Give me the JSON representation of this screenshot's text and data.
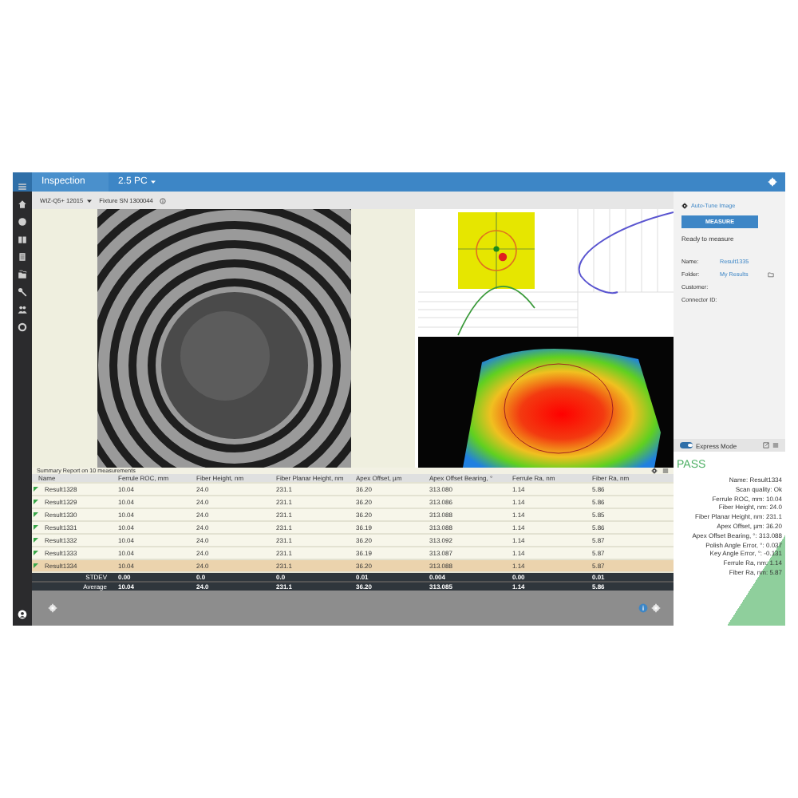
{
  "title_bar": {
    "app_title": "Inspection",
    "profile": "2.5 PC"
  },
  "sub_bar": {
    "device": "WIZ-Q5+ 12015",
    "fixture": "Fixture SN 1300044"
  },
  "control_panel": {
    "auto_tune": "Auto-Tune Image",
    "measure_button": "MEASURE",
    "status": "Ready to measure",
    "fields": [
      {
        "label": "Name:",
        "value": "Result1335"
      },
      {
        "label": "Folder:",
        "value": "My Results"
      },
      {
        "label": "Customer:"
      },
      {
        "label": "Connector ID:"
      }
    ]
  },
  "express_mode": {
    "label": "Express Mode",
    "on": true
  },
  "result": {
    "verdict": "PASS",
    "lines": [
      {
        "label": "Name:",
        "value": "Result1334"
      },
      {
        "label": "Scan quality:",
        "value": "Ok"
      },
      {
        "label": "Ferrule ROC, mm:",
        "value": "10.04"
      },
      {
        "label": "Fiber Height, nm:",
        "value": "24.0"
      },
      {
        "label": "Fiber Planar Height, nm:",
        "value": "231.1"
      },
      {
        "label": "Apex Offset, µm:",
        "value": "36.20"
      },
      {
        "label": "Apex Offset Bearing, °:",
        "value": "313.088"
      },
      {
        "label": "Polish Angle Error, °:",
        "value": "0.037"
      },
      {
        "label": "Key Angle Error, °:",
        "value": "-0.131"
      },
      {
        "label": "Ferrule Ra, nm:",
        "value": "1.14"
      },
      {
        "label": "Fiber Ra, nm:",
        "value": "5.87"
      }
    ]
  },
  "summary_table": {
    "title": "Summary Report on 10 measurements",
    "columns": [
      "Name",
      "Ferrule ROC, mm",
      "Fiber Height, nm",
      "Fiber Planar Height, nm",
      "Apex Offset, µm",
      "Apex Offset Bearing, °",
      "Ferrule Ra, nm",
      "Fiber Ra, nm"
    ],
    "rows": [
      {
        "flagged": true,
        "selected": false,
        "cells": [
          "Result1328",
          "10.04",
          "24.0",
          "231.1",
          "36.20",
          "313.080",
          "1.14",
          "5.86"
        ]
      },
      {
        "flagged": true,
        "selected": false,
        "cells": [
          "Result1329",
          "10.04",
          "24.0",
          "231.1",
          "36.20",
          "313.086",
          "1.14",
          "5.86"
        ]
      },
      {
        "flagged": true,
        "selected": false,
        "cells": [
          "Result1330",
          "10.04",
          "24.0",
          "231.1",
          "36.20",
          "313.088",
          "1.14",
          "5.85"
        ]
      },
      {
        "flagged": true,
        "selected": false,
        "cells": [
          "Result1331",
          "10.04",
          "24.0",
          "231.1",
          "36.19",
          "313.088",
          "1.14",
          "5.86"
        ]
      },
      {
        "flagged": true,
        "selected": false,
        "cells": [
          "Result1332",
          "10.04",
          "24.0",
          "231.1",
          "36.20",
          "313.092",
          "1.14",
          "5.87"
        ]
      },
      {
        "flagged": true,
        "selected": false,
        "cells": [
          "Result1333",
          "10.04",
          "24.0",
          "231.1",
          "36.19",
          "313.087",
          "1.14",
          "5.87"
        ]
      },
      {
        "flagged": true,
        "selected": true,
        "cells": [
          "Result1334",
          "10.04",
          "24.0",
          "231.1",
          "36.20",
          "313.088",
          "1.14",
          "5.87"
        ]
      }
    ],
    "stats": [
      {
        "label": "STDEV",
        "cells": [
          "0.00",
          "0.0",
          "0.0",
          "0.01",
          "0.004",
          "0.00",
          "0.01"
        ]
      },
      {
        "label": "Average",
        "cells": [
          "10.04",
          "24.0",
          "231.1",
          "36.20",
          "313.085",
          "1.14",
          "5.86"
        ]
      }
    ]
  }
}
